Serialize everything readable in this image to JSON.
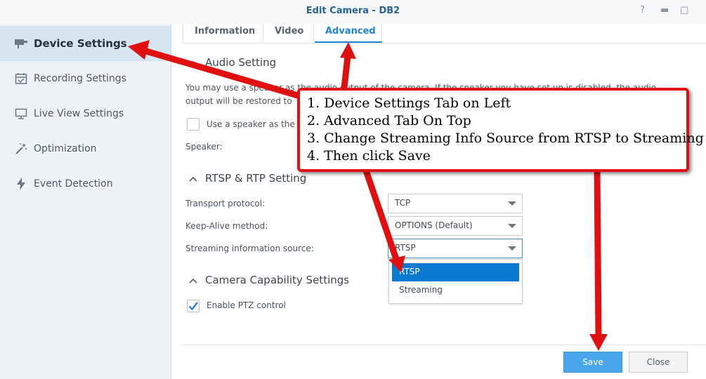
{
  "window": {
    "title": "Edit Camera - DB2",
    "help_glyph": "?",
    "minimize_glyph": "▬",
    "maximize_glyph": "□"
  },
  "sidebar": {
    "items": [
      {
        "label": "Device Settings",
        "icon": "camera-icon",
        "active": true
      },
      {
        "label": "Recording Settings",
        "icon": "calendar-icon",
        "active": false
      },
      {
        "label": "Live View Settings",
        "icon": "monitor-icon",
        "active": false
      },
      {
        "label": "Optimization",
        "icon": "magic-wand-icon",
        "active": false
      },
      {
        "label": "Event Detection",
        "icon": "lightning-icon",
        "active": false
      }
    ]
  },
  "tabs": [
    {
      "label": "Information",
      "active": false
    },
    {
      "label": "Video",
      "active": false
    },
    {
      "label": "Advanced",
      "active": true
    }
  ],
  "audio": {
    "title": "Audio Setting",
    "desc_line1": "You may use a speaker as the audio output of the camera. If the speaker you have set up is disabled, the audio",
    "desc_line2": "output will be restored to",
    "speaker_checkbox_label": "Use a speaker as the",
    "speaker_checked": false,
    "speaker_label": "Speaker:"
  },
  "rtsp": {
    "title": "RTSP & RTP Setting",
    "transport_label": "Transport protocol:",
    "transport_value": "TCP",
    "keepalive_label": "Keep-Alive method:",
    "keepalive_value": "OPTIONS (Default)",
    "source_label": "Streaming information source:",
    "source_value": "RTSP",
    "source_options": [
      "RTSP",
      "Streaming"
    ]
  },
  "capability": {
    "title": "Camera Capability Settings",
    "ptz_label": "Enable PTZ control",
    "ptz_checked": true
  },
  "footer": {
    "save_label": "Save",
    "close_label": "Close"
  },
  "annotation": {
    "line1": "1. Device Settings Tab on Left",
    "line2": "2. Advanced Tab On Top",
    "line3": "3. Change Streaming Info Source from RTSP to Streaming",
    "line4": "4. Then click Save"
  },
  "colors": {
    "accent": "#1f84d6",
    "selected_option": "#0b79d0",
    "save_button": "#4aa6ea",
    "annotation_red": "#e01010"
  }
}
